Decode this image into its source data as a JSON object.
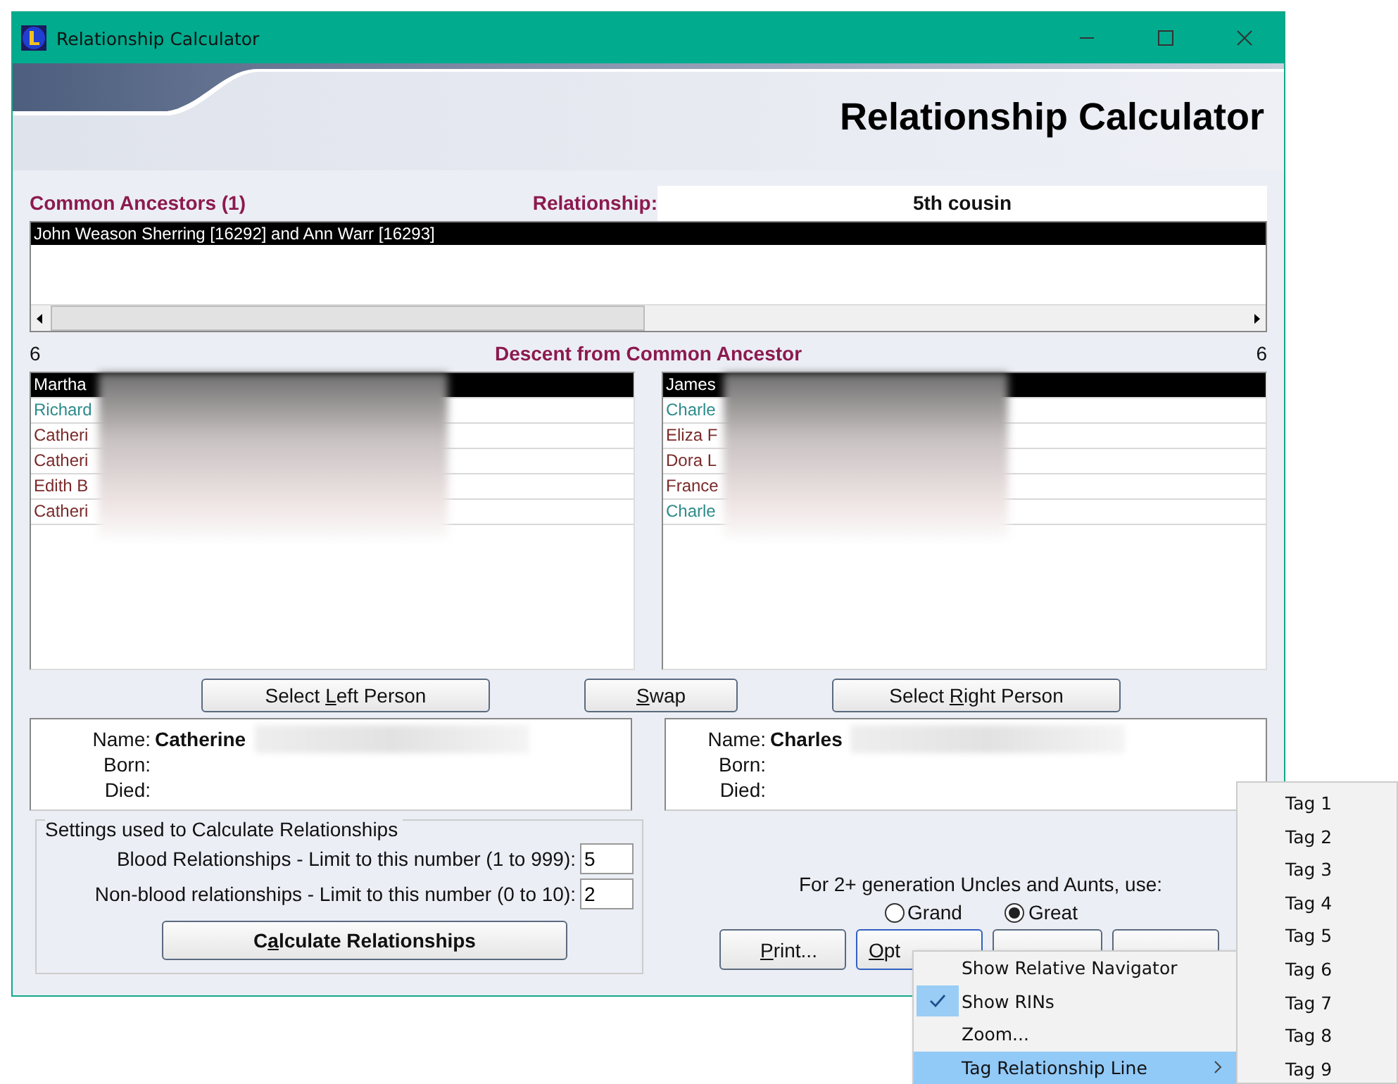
{
  "window": {
    "title": "Relationship Calculator"
  },
  "header": {
    "title": "Relationship Calculator"
  },
  "common_ancestors": {
    "label": "Common Ancestors (1)",
    "relationship_label": "Relationship:",
    "relationship_value": "5th cousin",
    "items": [
      {
        "text": "John Weason Sherring [16292] and Ann Warr [16293]",
        "selected": true
      }
    ]
  },
  "descent": {
    "left_count": "6",
    "title": "Descent from Common Ancestor",
    "right_count": "6",
    "left": [
      {
        "text": "Martha",
        "selected": true
      },
      {
        "text": "Richard",
        "selected": false,
        "color": "#2e8b8b"
      },
      {
        "text": "Catheri",
        "selected": false,
        "color": "#7a2a2a"
      },
      {
        "text": "Catheri",
        "selected": false,
        "color": "#7a2a2a"
      },
      {
        "text": "Edith B",
        "selected": false,
        "color": "#7a2a2a"
      },
      {
        "text": "Catheri",
        "selected": false,
        "color": "#7a2a2a"
      }
    ],
    "right": [
      {
        "text": "James",
        "selected": true
      },
      {
        "text": "Charle",
        "selected": false,
        "color": "#2e8b8b"
      },
      {
        "text": "Eliza F",
        "selected": false,
        "color": "#7a2a2a"
      },
      {
        "text": "Dora L",
        "selected": false,
        "color": "#7a2a2a"
      },
      {
        "text": "France",
        "selected": false,
        "color": "#7a2a2a"
      },
      {
        "text": "Charle",
        "selected": false,
        "color": "#2e8b8b"
      }
    ]
  },
  "person_buttons": [
    {
      "pre": "Select ",
      "key": "L",
      "post": "eft Person"
    },
    {
      "key": "S",
      "post": "wap"
    },
    {
      "pre": "Select ",
      "key": "R",
      "post": "ight Person"
    }
  ],
  "persons": [
    {
      "name_label": "Name:",
      "name": "Catherine",
      "born_label": "Born:",
      "died_label": "Died:"
    },
    {
      "name_label": "Name:",
      "name": "Charles",
      "born_label": "Born:",
      "died_label": "Died:"
    }
  ],
  "settings": {
    "title": "Settings used to Calculate Relationships",
    "rows": [
      {
        "label": "Blood Relationships - Limit to this number (1 to 999):",
        "value": "5"
      },
      {
        "label": "Non-blood relationships - Limit to this number (0 to 10):",
        "value": "2"
      }
    ],
    "button": {
      "pre": "C",
      "key": "a",
      "post": "lculate Relationships"
    }
  },
  "uncles": {
    "label": "For 2+ generation Uncles and Aunts, use:",
    "options": [
      {
        "label": "Grand",
        "selected": false
      },
      {
        "label": "Great",
        "selected": true
      }
    ]
  },
  "bottom_buttons": [
    {
      "kind": "label",
      "key": "P",
      "post": "rint..."
    },
    {
      "kind": "label",
      "key": "O",
      "post": "pt"
    },
    {
      "kind": "blank"
    },
    {
      "kind": "blank"
    }
  ],
  "context_menu": {
    "items": [
      {
        "label": "Show Relative Navigator",
        "checked": false,
        "highlighted": false,
        "has_submenu": false
      },
      {
        "label": "Show RINs",
        "checked": true,
        "highlighted": false,
        "has_submenu": false
      },
      {
        "label": "Zoom...",
        "checked": false,
        "highlighted": false,
        "has_submenu": false
      },
      {
        "label": "Tag Relationship Line",
        "checked": false,
        "highlighted": true,
        "has_submenu": true
      }
    ],
    "submenu": [
      "Tag 1",
      "Tag 2",
      "Tag 3",
      "Tag 4",
      "Tag 5",
      "Tag 6",
      "Tag 7",
      "Tag 8",
      "Tag 9"
    ]
  }
}
